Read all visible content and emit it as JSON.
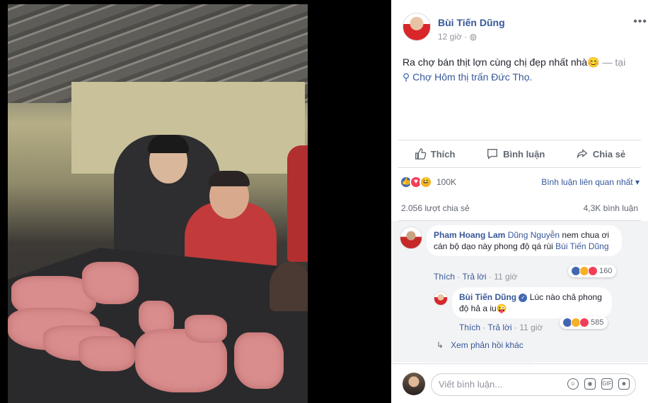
{
  "post": {
    "author": "Bùi Tiến Dũng",
    "time": "12 giờ",
    "more": "•••",
    "status_text": "Ra chợ bán thịt lợn cùng chị đẹp nhất nhà😊",
    "status_dash": " — tại ",
    "place": "Chợ Hôm thị trấn Đức Thọ."
  },
  "actions": {
    "like": "Thích",
    "comment": "Bình luận",
    "share": "Chia sẻ"
  },
  "reactions": {
    "count": "100K",
    "sort": "Bình luận liên quan nhất ▾"
  },
  "stats": {
    "shares": "2.056 lượt chia sẻ",
    "comments": "4,3K bình luận"
  },
  "comments": [
    {
      "name": "Pham Hoang Lam",
      "tag": "Dũng Nguyễn",
      "text": " nem chua ơi cán bộ dạo này phong độ qá rùi ",
      "tag2": "Bùi Tiến Dũng",
      "like": "Thích",
      "reply": "Trả lời",
      "time": "11 giờ",
      "react_count": "160"
    },
    {
      "name": "Bùi Tiến Dũng",
      "text": " Lúc nào chả phong độ hả a iu😜",
      "like": "Thích",
      "reply": "Trả lời",
      "time": "11 giờ",
      "react_count": "585"
    }
  ],
  "view_replies": "Xem phản hồi khác",
  "composer": {
    "placeholder": "Viết bình luận..."
  },
  "colors": {
    "link": "#365899",
    "like_blue": "#4267b2",
    "love_red": "#f33e58",
    "haha_yellow": "#f7b125"
  }
}
